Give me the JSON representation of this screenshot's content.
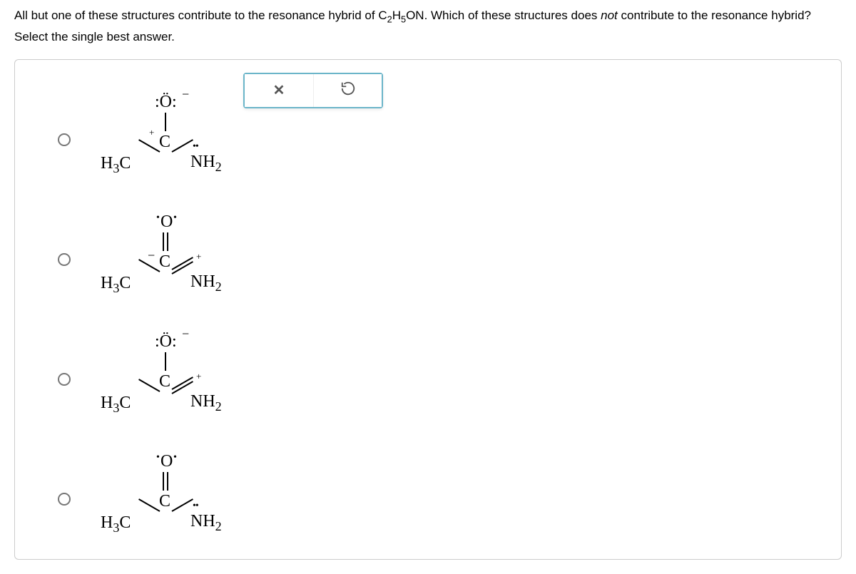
{
  "question": {
    "part1": "All but one of these structures contribute to the resonance hybrid of ",
    "formula_c": "C",
    "formula_2": "2",
    "formula_h": "H",
    "formula_5": "5",
    "formula_on": "ON",
    "part2": ". Which of these structures does ",
    "not_word": "not",
    "part3": " contribute to the resonance hybrid? Select the single best answer."
  },
  "labels": {
    "h3c": "H",
    "h3c_3": "3",
    "h3c_c": "C",
    "c": "C",
    "o_lone": ":Ö:",
    "o_dbl": "O",
    "nh": "NH",
    "nh_2": "2",
    "minus": "−",
    "plus": "+"
  }
}
